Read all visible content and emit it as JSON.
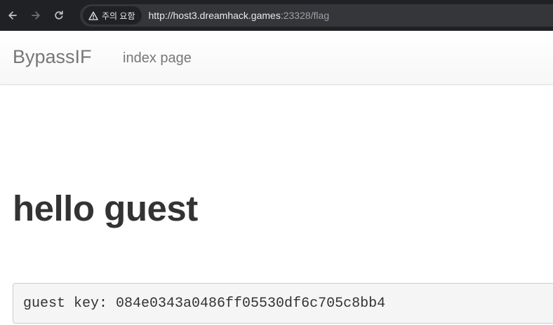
{
  "browser": {
    "back_icon": "arrow-left-icon",
    "forward_icon": "arrow-right-icon",
    "reload_icon": "reload-icon",
    "security_label": "주의 요함",
    "url_host": "http://host3.dreamhack.games",
    "url_path": ":23328/flag",
    "colors": {
      "bar": "#202124",
      "omnibox": "#35363a"
    }
  },
  "navbar": {
    "brand": "BypassIF",
    "link": "index page"
  },
  "main": {
    "heading": "hello guest",
    "key_text": "guest key: 084e0343a0486ff05530df6c705c8bb4"
  }
}
